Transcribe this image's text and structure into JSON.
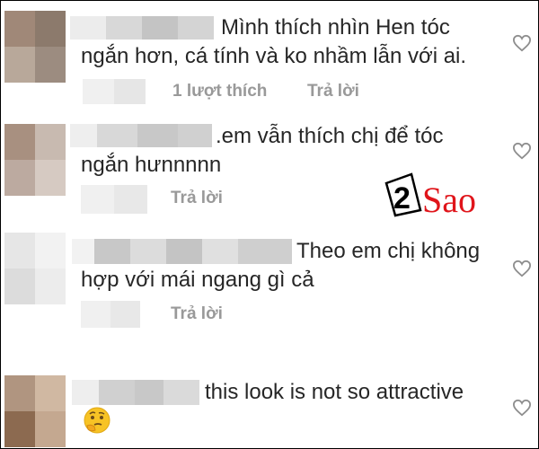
{
  "comments": [
    {
      "text_line1": "Mình thích nhìn Hen tóc",
      "text_line2": "ngắn hơn, cá tính và ko nhầm lẫn với ai.",
      "likes": "1 lượt thích",
      "reply": "Trả lời"
    },
    {
      "text_line1": ".em vẫn thích chị để tóc",
      "text_line2": "ngắn hưnnnnn",
      "reply": "Trả lời"
    },
    {
      "text_line1": "Theo em chị không",
      "text_line2": "hợp với mái ngang gì cả",
      "reply": "Trả lời"
    },
    {
      "text_line1": "this look is not so attractive"
    }
  ],
  "watermark": {
    "number": "2",
    "word": "Sao"
  },
  "icons": {
    "like": "heart-outline-icon",
    "emoji": "thinking-face-emoji"
  },
  "colors": {
    "text": "#262626",
    "muted": "#999999",
    "logo_red": "#e0151b"
  }
}
